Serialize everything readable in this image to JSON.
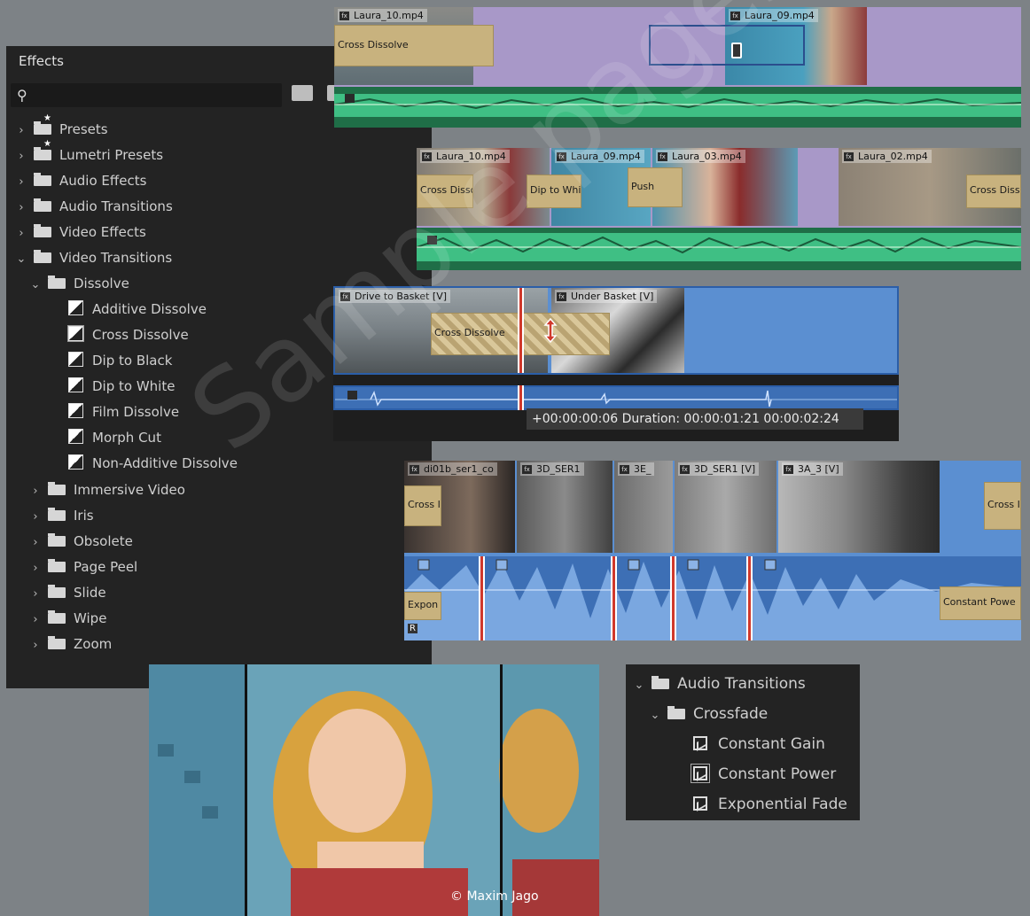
{
  "effects_panel": {
    "title": "Effects",
    "search": {
      "value": "",
      "placeholder": ""
    },
    "tree": [
      {
        "label": "Presets",
        "level": 0,
        "kind": "preset",
        "expanded": false
      },
      {
        "label": "Lumetri Presets",
        "level": 0,
        "kind": "preset",
        "expanded": false
      },
      {
        "label": "Audio Effects",
        "level": 0,
        "kind": "folder",
        "expanded": false
      },
      {
        "label": "Audio Transitions",
        "level": 0,
        "kind": "folder",
        "expanded": false
      },
      {
        "label": "Video Effects",
        "level": 0,
        "kind": "folder",
        "expanded": false
      },
      {
        "label": "Video Transitions",
        "level": 0,
        "kind": "folder",
        "expanded": true
      },
      {
        "label": "Dissolve",
        "level": 1,
        "kind": "folder",
        "expanded": true
      },
      {
        "label": "Additive Dissolve",
        "level": 2,
        "kind": "item"
      },
      {
        "label": "Cross Dissolve",
        "level": 2,
        "kind": "item",
        "selected": true
      },
      {
        "label": "Dip to Black",
        "level": 2,
        "kind": "item"
      },
      {
        "label": "Dip to White",
        "level": 2,
        "kind": "item"
      },
      {
        "label": "Film Dissolve",
        "level": 2,
        "kind": "item"
      },
      {
        "label": "Morph Cut",
        "level": 2,
        "kind": "item"
      },
      {
        "label": "Non-Additive Dissolve",
        "level": 2,
        "kind": "item"
      },
      {
        "label": "Immersive Video",
        "level": 1,
        "kind": "folder",
        "expanded": false
      },
      {
        "label": "Iris",
        "level": 1,
        "kind": "folder",
        "expanded": false
      },
      {
        "label": "Obsolete",
        "level": 1,
        "kind": "folder",
        "expanded": false
      },
      {
        "label": "Page Peel",
        "level": 1,
        "kind": "folder",
        "expanded": false
      },
      {
        "label": "Slide",
        "level": 1,
        "kind": "folder",
        "expanded": false
      },
      {
        "label": "Wipe",
        "level": 1,
        "kind": "folder",
        "expanded": false
      },
      {
        "label": "Zoom",
        "level": 1,
        "kind": "folder",
        "expanded": false
      }
    ]
  },
  "timeline1": {
    "clips": [
      "Laura_10.mp4",
      "Laura_09.mp4"
    ],
    "transition": "Cross Dissolve",
    "fx_badge": "fx"
  },
  "timeline2": {
    "clips": [
      "Laura_10.mp4",
      "Laura_09.mp4",
      "Laura_03.mp4",
      "Laura_02.mp4"
    ],
    "transitions": [
      "Cross Dissol",
      "Dip to Whit",
      "Push",
      "Cross Disso"
    ]
  },
  "timeline3": {
    "clips": [
      "Drive to Basket [V]",
      "Under Basket [V]"
    ],
    "transition": "Cross Dissolve",
    "tooltip": "+00:00:00:06 Duration: 00:00:01:21 00:00:02:24"
  },
  "timeline4": {
    "clips": [
      "di01b_ser1_co",
      "3D_SER1",
      "3E_",
      "3D_SER1 [V]",
      "3A_3 [V]"
    ],
    "video_transitions": [
      "Cross I",
      "Cross I"
    ],
    "audio_transitions": [
      "Expon",
      "Constant Powe"
    ],
    "r_label": "R"
  },
  "audio_transitions_panel": {
    "tree": [
      {
        "label": "Audio Transitions",
        "level": 0,
        "kind": "folder"
      },
      {
        "label": "Crossfade",
        "level": 1,
        "kind": "folder"
      },
      {
        "label": "Constant Gain",
        "level": 2,
        "kind": "item"
      },
      {
        "label": "Constant Power",
        "level": 2,
        "kind": "item",
        "selected": true
      },
      {
        "label": "Exponential Fade",
        "level": 2,
        "kind": "item"
      }
    ]
  },
  "photo": {
    "credit": "© Maxim Jago"
  },
  "watermark": "Sample pages",
  "colors": {
    "panel_bg": "#232323",
    "canvas_bg": "#7d8286",
    "clip_purple": "#a898c8",
    "clip_blue": "#5b8fd1",
    "transition_tan": "#c8b27e",
    "audio_green": "#2f8f5f",
    "audio_red": "#d0382b"
  }
}
